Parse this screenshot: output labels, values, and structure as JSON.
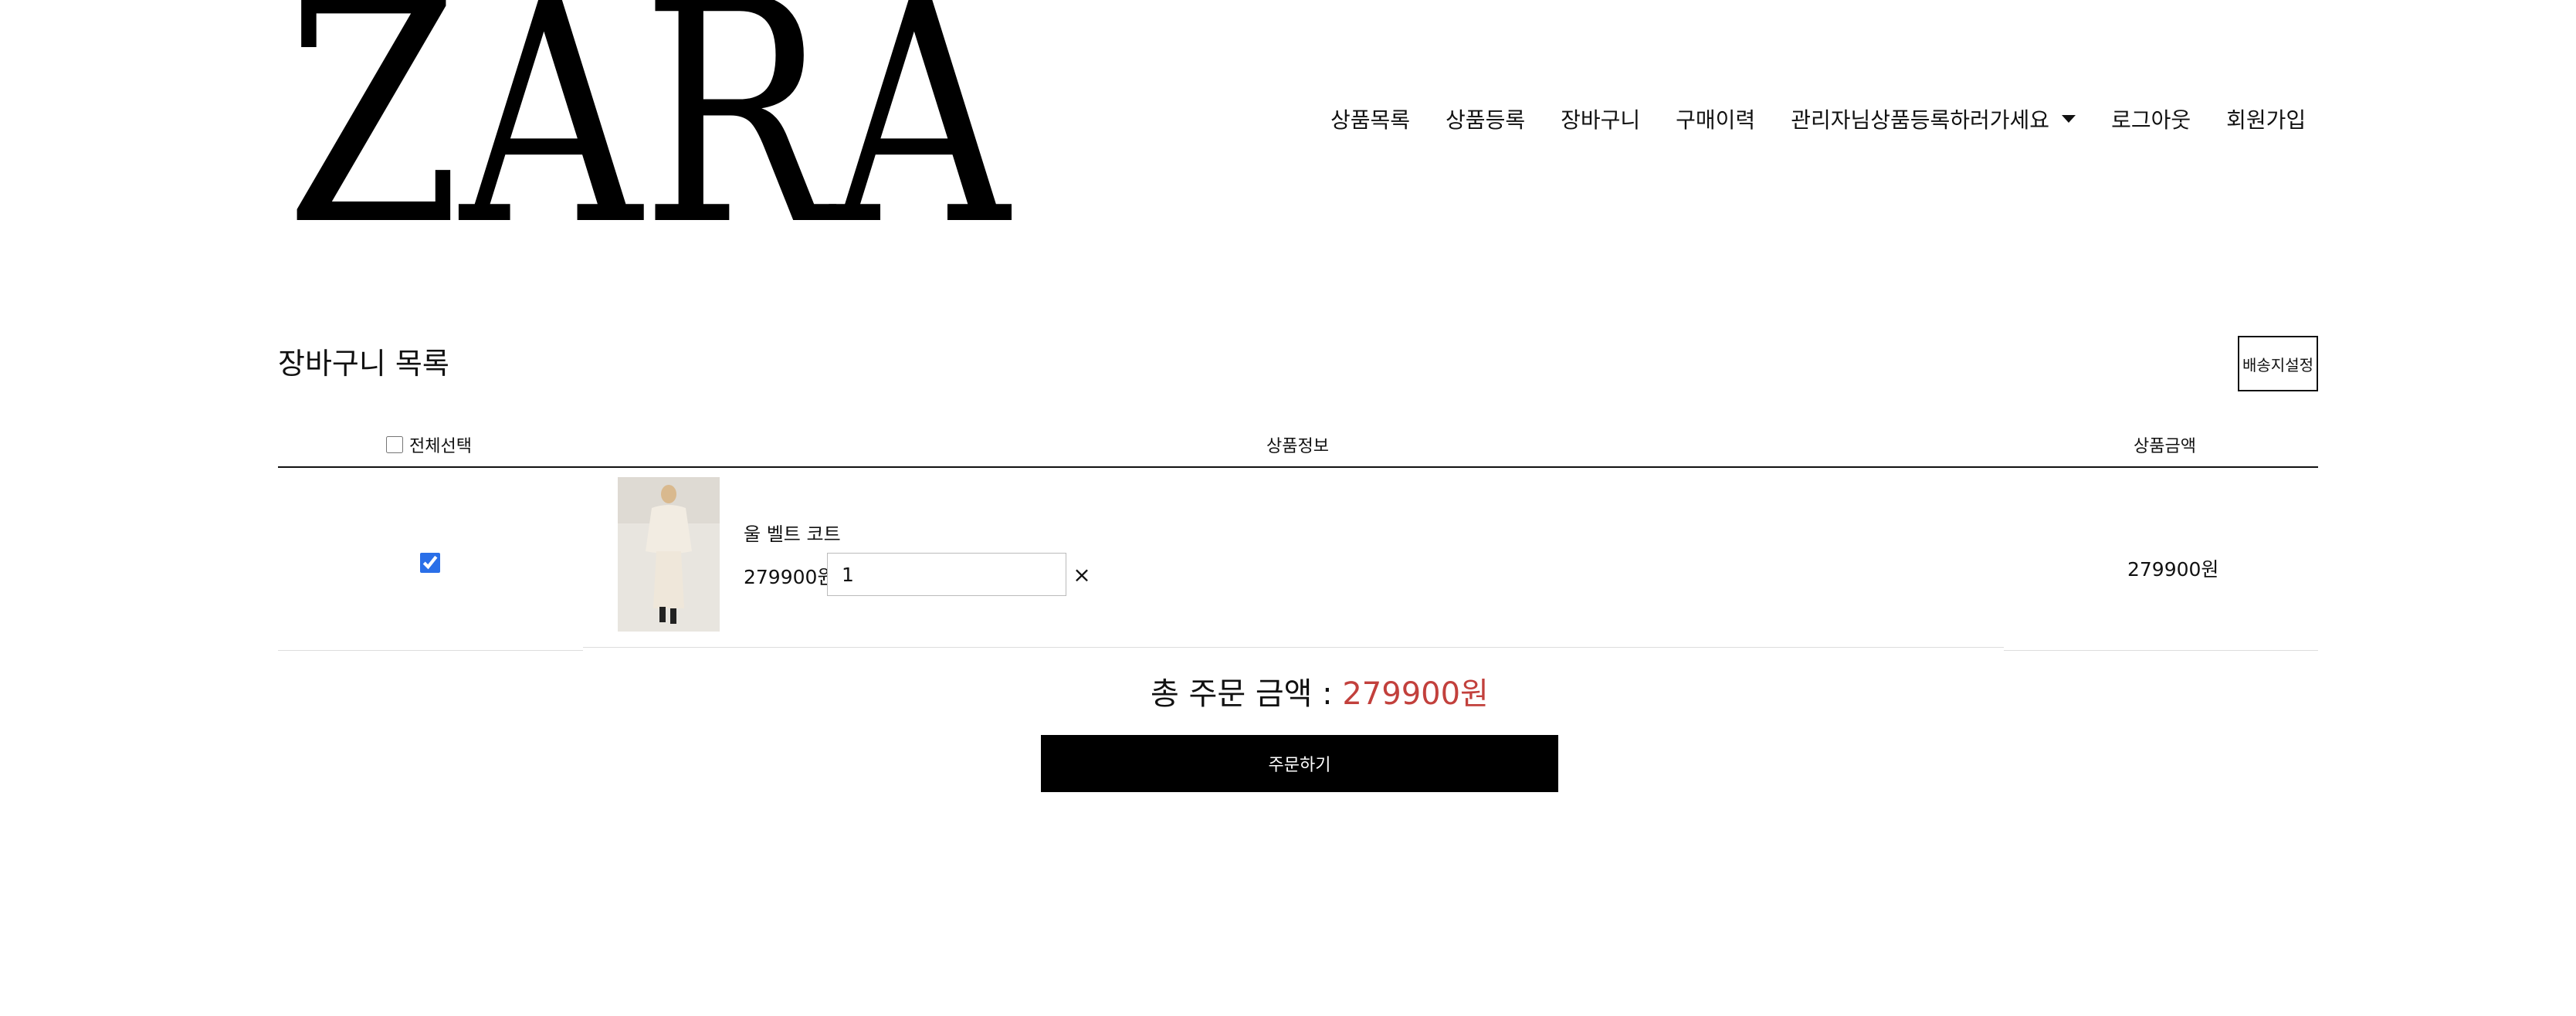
{
  "brand": {
    "logo_text": "ZARA"
  },
  "nav": {
    "items": [
      {
        "label": "상품목록"
      },
      {
        "label": "상품등록"
      },
      {
        "label": "장바구니"
      },
      {
        "label": "구매이력"
      },
      {
        "label": "관리자님상품등록하러가세요"
      },
      {
        "label": "로그아웃"
      },
      {
        "label": "회원가입"
      }
    ]
  },
  "cart": {
    "title": "장바구니 목록",
    "shipping_button": "배송지설정",
    "headers": {
      "select_all": "전체선택",
      "product_info": "상품정보",
      "product_price": "상품금액"
    },
    "items": [
      {
        "name": "울 벨트 코트",
        "price": "279900원",
        "quantity": "1",
        "remove_icon": "×",
        "row_total": "279900원",
        "checked": true
      }
    ],
    "total_label": "총 주문 금액 : ",
    "total_amount": "279900원",
    "order_button": "주문하기"
  },
  "colors": {
    "accent_total": "#c2403c",
    "checkbox": "#2a6fe8",
    "button_bg": "#000000"
  }
}
